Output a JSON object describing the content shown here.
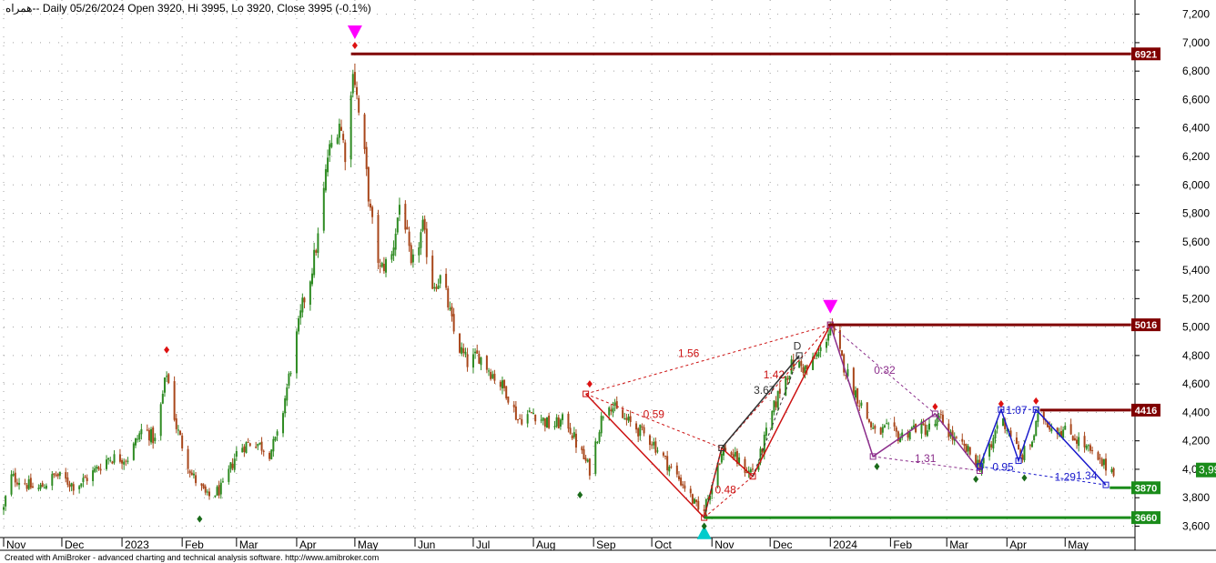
{
  "chart_data": {
    "type": "candlestick",
    "header": {
      "symbol": "همراه-",
      "text": "- Daily 05/26/2024 Open 3920, Hi 3995, Lo 3920, Close 3995 (-0.1%)"
    },
    "footer": "Created with AmiBroker - advanced charting and technical analysis software. http://www.amibroker.com",
    "y_axis": {
      "ylim": [
        3520,
        7300
      ],
      "ticks": [
        {
          "value": 3600,
          "label": "3,600"
        },
        {
          "value": 3800,
          "label": "3,800"
        },
        {
          "value": 4000,
          "label": "4,000"
        },
        {
          "value": 4200,
          "label": "4,200"
        },
        {
          "value": 4400,
          "label": "4,400"
        },
        {
          "value": 4600,
          "label": "4,600"
        },
        {
          "value": 4800,
          "label": "4,800"
        },
        {
          "value": 5000,
          "label": "5,000"
        },
        {
          "value": 5200,
          "label": "5,200"
        },
        {
          "value": 5400,
          "label": "5,400"
        },
        {
          "value": 5600,
          "label": "5,600"
        },
        {
          "value": 5800,
          "label": "5,800"
        },
        {
          "value": 6000,
          "label": "6,000"
        },
        {
          "value": 6200,
          "label": "6,200"
        },
        {
          "value": 6400,
          "label": "6,400"
        },
        {
          "value": 6600,
          "label": "6,600"
        },
        {
          "value": 6800,
          "label": "6,800"
        },
        {
          "value": 7000,
          "label": "7,000"
        },
        {
          "value": 7200,
          "label": "7,200"
        }
      ]
    },
    "x_axis": {
      "range": [
        "2022-11-01",
        "2024-06-06"
      ],
      "ticks": [
        {
          "date": "2022-11-01",
          "label": "Nov"
        },
        {
          "date": "2022-12-01",
          "label": "Dec"
        },
        {
          "date": "2023-01-01",
          "label": "2023"
        },
        {
          "date": "2023-02-01",
          "label": "Feb"
        },
        {
          "date": "2023-03-01",
          "label": "Mar"
        },
        {
          "date": "2023-04-01",
          "label": "Apr"
        },
        {
          "date": "2023-05-01",
          "label": "May"
        },
        {
          "date": "2023-06-01",
          "label": "Jun"
        },
        {
          "date": "2023-07-01",
          "label": "Jul"
        },
        {
          "date": "2023-08-01",
          "label": "Aug"
        },
        {
          "date": "2023-09-01",
          "label": "Sep"
        },
        {
          "date": "2023-10-01",
          "label": "Oct"
        },
        {
          "date": "2023-11-01",
          "label": "Nov"
        },
        {
          "date": "2023-12-01",
          "label": "Dec"
        },
        {
          "date": "2024-01-01",
          "label": "2024"
        },
        {
          "date": "2024-02-01",
          "label": "Feb"
        },
        {
          "date": "2024-03-01",
          "label": "Mar"
        },
        {
          "date": "2024-04-01",
          "label": "Apr"
        },
        {
          "date": "2024-05-01",
          "label": "May"
        }
      ]
    },
    "price_path": [
      {
        "date": "2022-11-01",
        "close": 3720
      },
      {
        "date": "2022-11-04",
        "close": 3950
      },
      {
        "date": "2022-11-10",
        "close": 3920
      },
      {
        "date": "2022-11-18",
        "close": 3850
      },
      {
        "date": "2022-11-28",
        "close": 3960
      },
      {
        "date": "2022-12-08",
        "close": 3880
      },
      {
        "date": "2022-12-15",
        "close": 3950
      },
      {
        "date": "2022-12-25",
        "close": 4080
      },
      {
        "date": "2023-01-04",
        "close": 4080
      },
      {
        "date": "2023-01-12",
        "close": 4300
      },
      {
        "date": "2023-01-18",
        "close": 4200
      },
      {
        "date": "2023-01-24",
        "close": 4680
      },
      {
        "date": "2023-01-29",
        "close": 4300
      },
      {
        "date": "2023-02-06",
        "close": 3960
      },
      {
        "date": "2023-02-14",
        "close": 3800
      },
      {
        "date": "2023-02-22",
        "close": 3870
      },
      {
        "date": "2023-03-02",
        "close": 4150
      },
      {
        "date": "2023-03-10",
        "close": 4200
      },
      {
        "date": "2023-03-18",
        "close": 4120
      },
      {
        "date": "2023-03-23",
        "close": 4250
      },
      {
        "date": "2023-03-26",
        "close": 4500
      },
      {
        "date": "2023-04-04",
        "close": 5150
      },
      {
        "date": "2023-04-08",
        "close": 5350
      },
      {
        "date": "2023-04-13",
        "close": 5700
      },
      {
        "date": "2023-04-17",
        "close": 6200
      },
      {
        "date": "2023-04-23",
        "close": 6450
      },
      {
        "date": "2023-04-27",
        "close": 6150
      },
      {
        "date": "2023-04-30",
        "close": 6850
      },
      {
        "date": "2023-05-03",
        "close": 6500
      },
      {
        "date": "2023-05-06",
        "close": 6200
      },
      {
        "date": "2023-05-09",
        "close": 5800
      },
      {
        "date": "2023-05-14",
        "close": 5400
      },
      {
        "date": "2023-05-20",
        "close": 5500
      },
      {
        "date": "2023-05-25",
        "close": 5950
      },
      {
        "date": "2023-05-30",
        "close": 5400
      },
      {
        "date": "2023-06-05",
        "close": 5700
      },
      {
        "date": "2023-06-10",
        "close": 5300
      },
      {
        "date": "2023-06-15",
        "close": 5350
      },
      {
        "date": "2023-06-22",
        "close": 4900
      },
      {
        "date": "2023-06-28",
        "close": 4750
      },
      {
        "date": "2023-07-04",
        "close": 4800
      },
      {
        "date": "2023-07-12",
        "close": 4650
      },
      {
        "date": "2023-07-18",
        "close": 4550
      },
      {
        "date": "2023-07-24",
        "close": 4350
      },
      {
        "date": "2023-08-01",
        "close": 4400
      },
      {
        "date": "2023-08-10",
        "close": 4300
      },
      {
        "date": "2023-08-18",
        "close": 4350
      },
      {
        "date": "2023-08-24",
        "close": 4150
      },
      {
        "date": "2023-08-30",
        "close": 4000
      },
      {
        "date": "2023-09-04",
        "close": 4300
      },
      {
        "date": "2023-09-08",
        "close": 4500
      },
      {
        "date": "2023-09-14",
        "close": 4380
      },
      {
        "date": "2023-09-22",
        "close": 4300
      },
      {
        "date": "2023-10-01",
        "close": 4200
      },
      {
        "date": "2023-10-10",
        "close": 4020
      },
      {
        "date": "2023-10-18",
        "close": 3880
      },
      {
        "date": "2023-10-26",
        "close": 3680
      },
      {
        "date": "2023-10-30",
        "close": 3800
      },
      {
        "date": "2023-11-04",
        "close": 4050
      },
      {
        "date": "2023-11-08",
        "close": 4150
      },
      {
        "date": "2023-11-14",
        "close": 4060
      },
      {
        "date": "2023-11-20",
        "close": 3980
      },
      {
        "date": "2023-11-25",
        "close": 4050
      },
      {
        "date": "2023-12-01",
        "close": 4350
      },
      {
        "date": "2023-12-07",
        "close": 4600
      },
      {
        "date": "2023-12-13",
        "close": 4750
      },
      {
        "date": "2023-12-20",
        "close": 4700
      },
      {
        "date": "2023-12-28",
        "close": 4850
      },
      {
        "date": "2024-01-01",
        "close": 5016
      },
      {
        "date": "2024-01-06",
        "close": 4800
      },
      {
        "date": "2024-01-12",
        "close": 4600
      },
      {
        "date": "2024-01-18",
        "close": 4420
      },
      {
        "date": "2024-01-24",
        "close": 4250
      },
      {
        "date": "2024-01-30",
        "close": 4280
      },
      {
        "date": "2024-02-06",
        "close": 4230
      },
      {
        "date": "2024-02-14",
        "close": 4300
      },
      {
        "date": "2024-02-20",
        "close": 4280
      },
      {
        "date": "2024-02-27",
        "close": 4350
      },
      {
        "date": "2024-03-05",
        "close": 4200
      },
      {
        "date": "2024-03-12",
        "close": 4120
      },
      {
        "date": "2024-03-18",
        "close": 4030
      },
      {
        "date": "2024-03-24",
        "close": 4150
      },
      {
        "date": "2024-03-28",
        "close": 4380
      },
      {
        "date": "2024-04-03",
        "close": 4250
      },
      {
        "date": "2024-04-08",
        "close": 4080
      },
      {
        "date": "2024-04-14",
        "close": 4200
      },
      {
        "date": "2024-04-18",
        "close": 4400
      },
      {
        "date": "2024-04-24",
        "close": 4300
      },
      {
        "date": "2024-05-04",
        "close": 4250
      },
      {
        "date": "2024-05-12",
        "close": 4150
      },
      {
        "date": "2024-05-18",
        "close": 4050
      },
      {
        "date": "2024-05-26",
        "close": 3995
      }
    ],
    "levels": [
      {
        "value": 6921,
        "label": "6921",
        "color": "#800000",
        "from": "2023-04-29",
        "to": "2024-06-04"
      },
      {
        "value": 5016,
        "label": "5016",
        "color": "#800000",
        "from": "2023-12-31",
        "to": "2024-06-04"
      },
      {
        "value": 4416,
        "label": "4416",
        "color": "#800000",
        "from": "2024-04-18",
        "to": "2024-06-04"
      },
      {
        "value": 3870,
        "label": "3870",
        "color": "#1a8c1a",
        "from": "2024-05-24",
        "to": "2024-06-04"
      },
      {
        "value": 3660,
        "label": "3660",
        "color": "#1a8c1a",
        "from": "2023-10-28",
        "to": "2024-06-04"
      }
    ],
    "last_price": {
      "value": 3995,
      "label": "3,995",
      "color": "#1a8c1a"
    },
    "patterns": [
      {
        "color": "#cc1111",
        "solid": [
          [
            "2023-08-28",
            4530
          ],
          [
            "2023-10-28",
            3660
          ],
          [
            "2023-11-06",
            4150
          ],
          [
            "2023-11-22",
            3950
          ],
          [
            "2024-01-01",
            5016
          ]
        ],
        "dashed": [
          [
            [
              "2023-08-28",
              4530
            ],
            [
              "2023-11-06",
              4150
            ]
          ],
          [
            [
              "2023-10-28",
              3660
            ],
            [
              "2023-11-22",
              3950
            ]
          ],
          [
            [
              "2023-11-06",
              4150
            ],
            [
              "2024-01-01",
              5016
            ]
          ],
          [
            [
              "2023-08-28",
              4530
            ],
            [
              "2024-01-01",
              5016
            ]
          ]
        ],
        "labels": [
          {
            "text": "1.56",
            "date": "2023-10-20",
            "price": 4790
          },
          {
            "text": "0.59",
            "date": "2023-10-02",
            "price": 4360
          },
          {
            "text": "0.48",
            "date": "2023-11-08",
            "price": 3830
          },
          {
            "text": "1.42",
            "date": "2023-12-03",
            "price": 4640
          }
        ]
      },
      {
        "color": "#333333",
        "solid": [
          [
            "2023-11-06",
            4150
          ],
          [
            "2023-12-16",
            4800
          ]
        ],
        "dashed": [
          [
            [
              "2023-10-28",
              3660
            ],
            [
              "2023-11-06",
              4150
            ]
          ],
          [
            [
              "2023-11-22",
              3950
            ],
            [
              "2023-12-16",
              4800
            ]
          ]
        ],
        "labels": [
          {
            "text": "3.67",
            "date": "2023-11-28",
            "price": 4530
          },
          {
            "text": "D",
            "date": "2023-12-15",
            "price": 4840
          }
        ]
      },
      {
        "color": "#8b2d8b",
        "solid": [
          [
            "2024-01-01",
            5016
          ],
          [
            "2024-01-23",
            4090
          ],
          [
            "2024-02-24",
            4390
          ],
          [
            "2024-03-18",
            3990
          ]
        ],
        "dashed": [
          [
            [
              "2024-01-01",
              5016
            ],
            [
              "2024-02-24",
              4390
            ]
          ],
          [
            [
              "2024-01-23",
              4090
            ],
            [
              "2024-03-18",
              3990
            ]
          ]
        ],
        "labels": [
          {
            "text": "0.32",
            "date": "2024-01-29",
            "price": 4670
          },
          {
            "text": "1.31",
            "date": "2024-02-19",
            "price": 4050
          }
        ]
      },
      {
        "color": "#1a1acc",
        "solid": [
          [
            "2024-03-18",
            4020
          ],
          [
            "2024-03-29",
            4420
          ],
          [
            "2024-04-07",
            4060
          ],
          [
            "2024-04-16",
            4420
          ],
          [
            "2024-05-22",
            3890
          ]
        ],
        "dashed": [
          [
            [
              "2024-03-18",
              4020
            ],
            [
              "2024-05-22",
              3890
            ]
          ],
          [
            [
              "2024-03-29",
              4420
            ],
            [
              "2024-04-16",
              4420
            ]
          ]
        ],
        "labels": [
          {
            "text": "1.07",
            "date": "2024-04-06",
            "price": 4390
          },
          {
            "text": "0.95",
            "date": "2024-03-30",
            "price": 3990
          },
          {
            "text": "1.29",
            "date": "2024-05-01",
            "price": 3920
          },
          {
            "text": "1.34",
            "date": "2024-05-12",
            "price": 3930
          }
        ]
      }
    ],
    "arrows": [
      {
        "date": "2023-05-01",
        "price": 7070,
        "dir": "down",
        "color": "#ff00ff"
      },
      {
        "date": "2024-01-01",
        "price": 5140,
        "dir": "down",
        "color": "#ff00ff"
      },
      {
        "date": "2023-10-28",
        "price": 3560,
        "dir": "up",
        "color": "#00cccc"
      }
    ],
    "dots": [
      {
        "date": "2023-01-24",
        "price": 4840,
        "color": "#dd1111"
      },
      {
        "date": "2023-05-01",
        "price": 6980,
        "color": "#dd1111"
      },
      {
        "date": "2023-08-30",
        "price": 4600,
        "color": "#dd1111"
      },
      {
        "date": "2024-02-24",
        "price": 4440,
        "color": "#dd1111"
      },
      {
        "date": "2024-03-29",
        "price": 4460,
        "color": "#dd1111"
      },
      {
        "date": "2024-04-16",
        "price": 4480,
        "color": "#dd1111"
      },
      {
        "date": "2023-02-10",
        "price": 3650,
        "color": "#1a6b1a"
      },
      {
        "date": "2023-08-25",
        "price": 3820,
        "color": "#1a6b1a"
      },
      {
        "date": "2023-10-28",
        "price": 3600,
        "color": "#1a6b1a"
      },
      {
        "date": "2024-01-25",
        "price": 4020,
        "color": "#1a6b1a"
      },
      {
        "date": "2024-03-16",
        "price": 3930,
        "color": "#1a6b1a"
      },
      {
        "date": "2024-04-10",
        "price": 3940,
        "color": "#1a6b1a"
      }
    ]
  }
}
